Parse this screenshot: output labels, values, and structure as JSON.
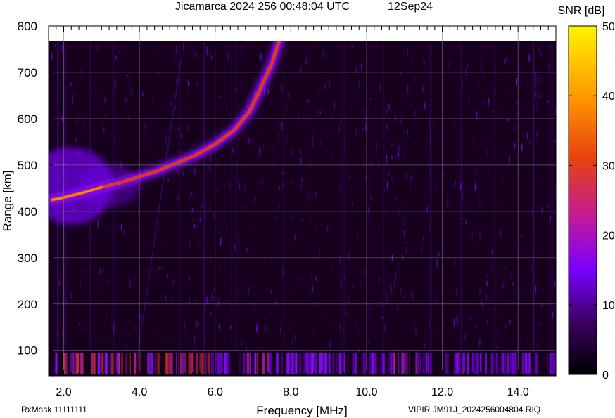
{
  "chart_data": {
    "type": "heatmap",
    "title": "Jicamarca 2024 256 00:48:04 UTC",
    "date": "12Sep24",
    "xlabel": "Frequency [MHz]",
    "ylabel": "Range [km]",
    "xlim": [
      1.6,
      15.0
    ],
    "ylim": [
      45,
      800
    ],
    "x_ticks": [
      "2.0",
      "4.0",
      "6.0",
      "8.0",
      "10.0",
      "12.0",
      "14.0"
    ],
    "y_ticks": [
      "100",
      "200",
      "300",
      "400",
      "500",
      "600",
      "700",
      "800"
    ],
    "colorbar": {
      "label": "SNR [dB]",
      "range": [
        0,
        50
      ],
      "ticks": [
        "0",
        "10",
        "20",
        "30",
        "40",
        "50"
      ],
      "colors": [
        "#000000",
        "#3a0060",
        "#7a00ff",
        "#c2199b",
        "#e8420d",
        "#ff9a00",
        "#fff300"
      ]
    },
    "trace": {
      "description": "ionogram echo trace",
      "frequency_mhz": [
        1.7,
        2.0,
        2.5,
        3.0,
        3.5,
        4.0,
        4.5,
        5.0,
        5.5,
        6.0,
        6.5,
        6.9,
        7.2,
        7.5,
        7.7
      ],
      "range_km": [
        425,
        430,
        440,
        452,
        462,
        475,
        488,
        505,
        522,
        545,
        575,
        615,
        665,
        720,
        770
      ]
    },
    "grid": true,
    "footer_left": "RxMask 11111111",
    "footer_right": "VIPIR  JM91J_2024256004804.RIQ"
  }
}
